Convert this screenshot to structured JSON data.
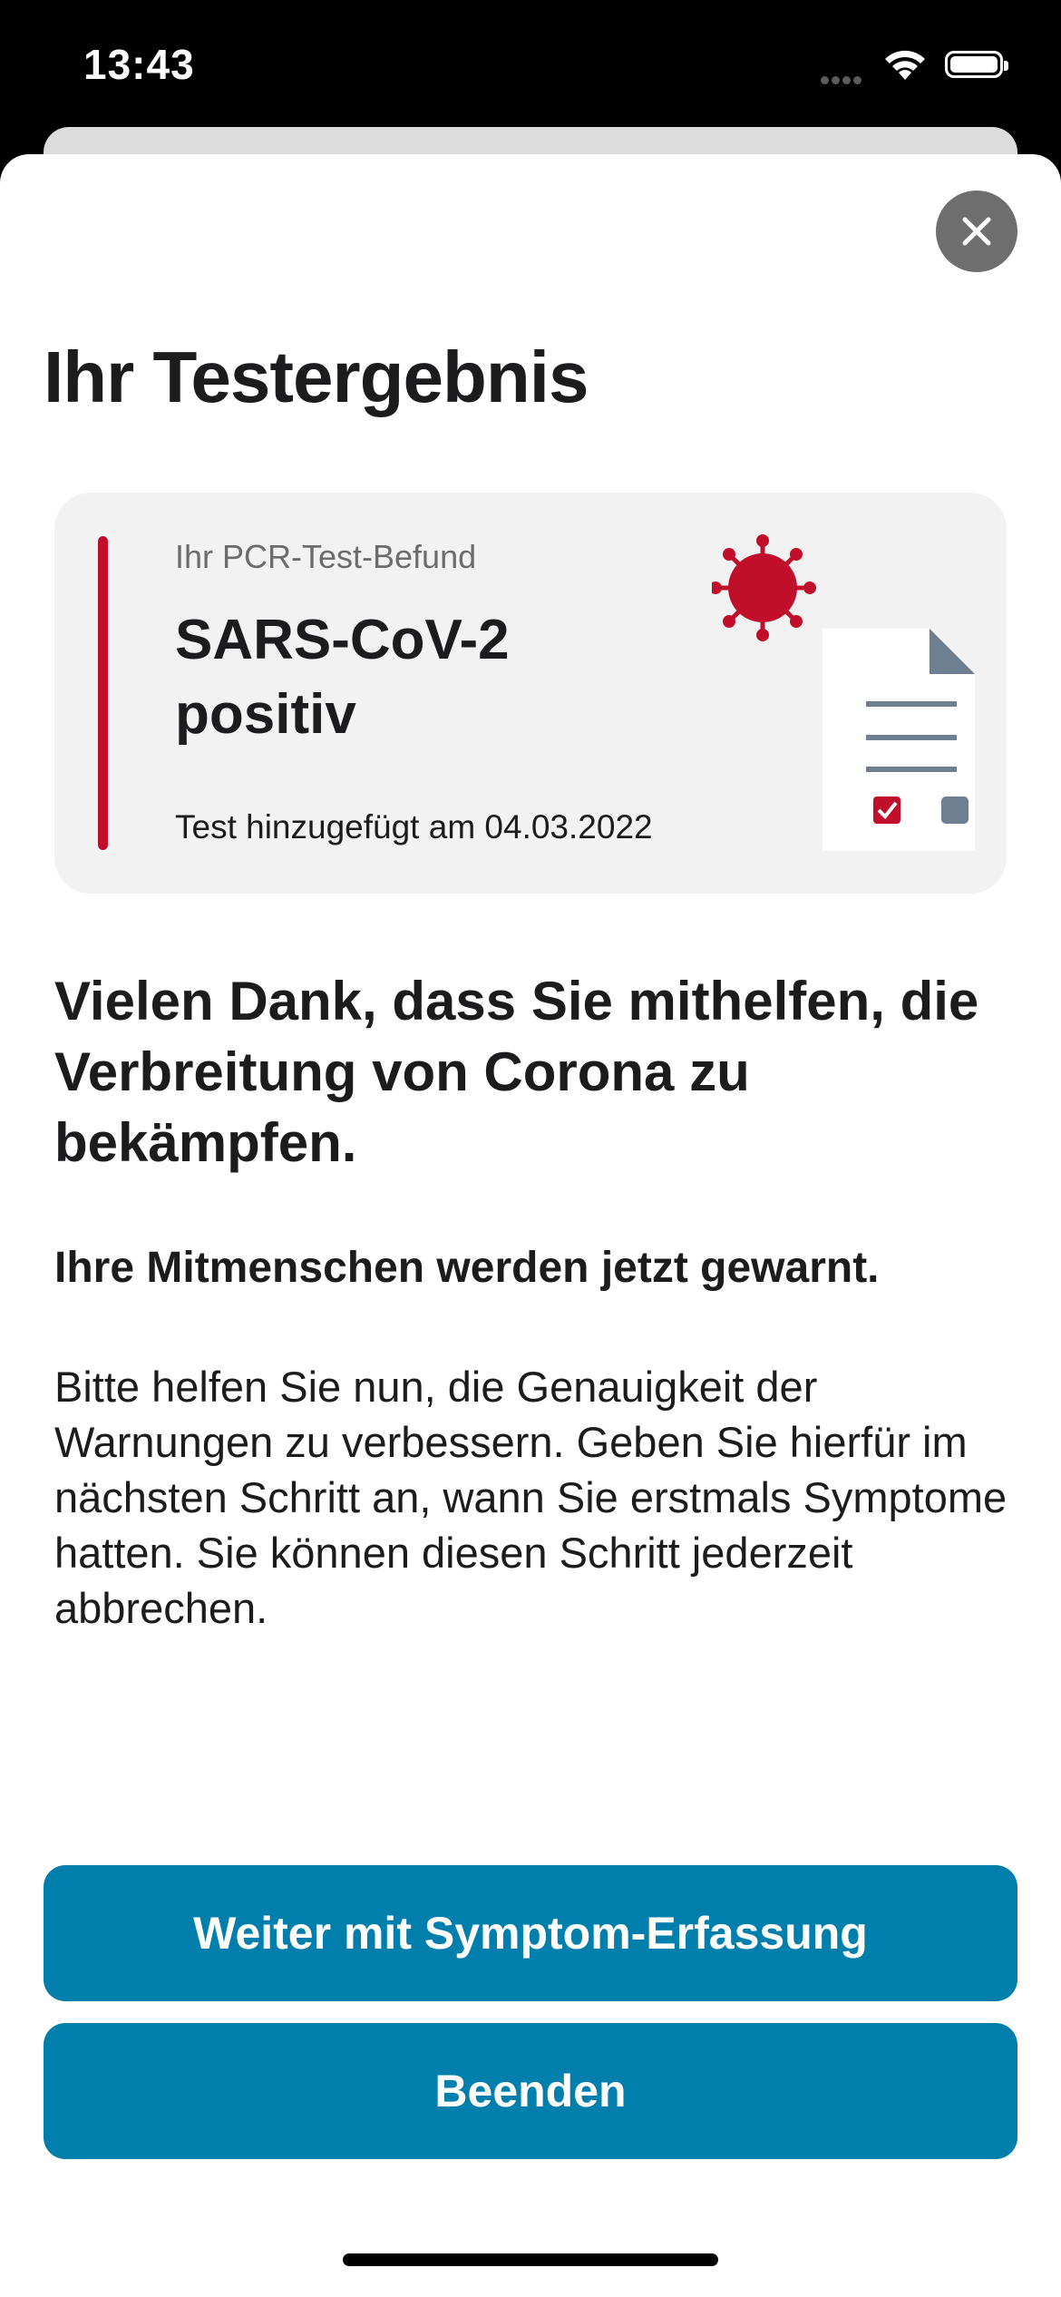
{
  "status_bar": {
    "time": "13:43"
  },
  "sheet": {
    "title": "Ihr Testergebnis",
    "close_icon": "close-icon"
  },
  "result_card": {
    "label": "Ihr PCR-Test-Befund",
    "result": "SARS-CoV-2 positiv",
    "date_text": "Test hinzugefügt am 04.03.2022",
    "accent_color": "#c10f2b",
    "illustration": "virus-document-icon"
  },
  "content": {
    "headline": "Vielen Dank, dass Sie mithelfen, die Verbreitung von Corona zu bekämpfen.",
    "subheadline": "Ihre Mitmenschen werden jetzt gewarnt.",
    "body": "Bitte helfen Sie nun, die Genauigkeit der Warnungen zu verbessern. Geben Sie hierfür im nächsten Schritt an, wann Sie erstmals Symptome hatten. Sie können diesen Schritt jederzeit abbrechen."
  },
  "buttons": {
    "primary_label": "Weiter mit Symptom-Erfassung",
    "secondary_label": "Beenden",
    "color": "#007fad"
  }
}
